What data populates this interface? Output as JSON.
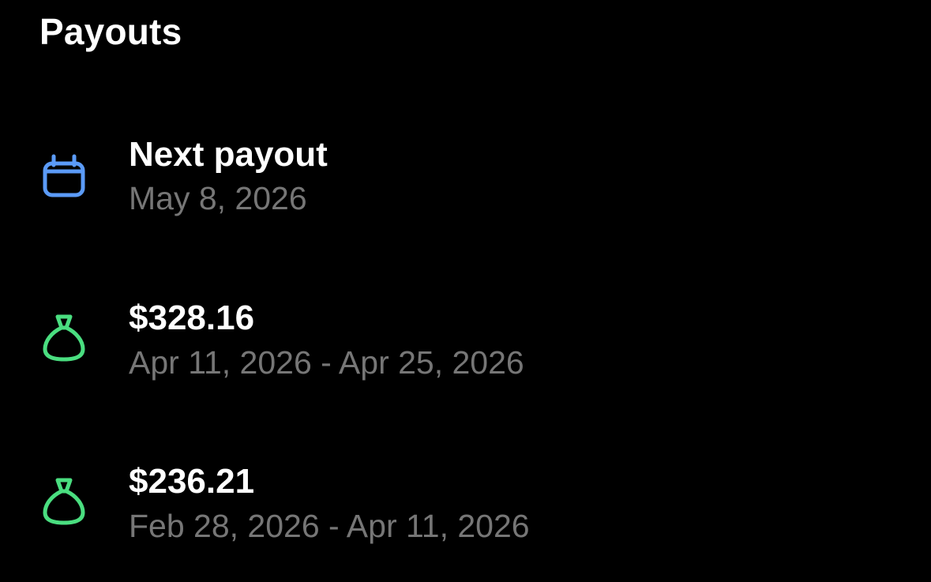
{
  "header": {
    "title": "Payouts"
  },
  "colors": {
    "background": "#000000",
    "primary_text": "#ffffff",
    "secondary_text": "#767676",
    "calendar_icon": "#5b9bf8",
    "money_bag_icon": "#4ade80"
  },
  "payouts": {
    "next": {
      "icon": "calendar-icon",
      "title": "Next payout",
      "date": "May 8, 2026"
    },
    "history": [
      {
        "icon": "money-bag-icon",
        "amount": "$328.16",
        "period": "Apr 11, 2026 - Apr 25, 2026"
      },
      {
        "icon": "money-bag-icon",
        "amount": "$236.21",
        "period": "Feb 28, 2026 - Apr 11, 2026"
      }
    ]
  }
}
